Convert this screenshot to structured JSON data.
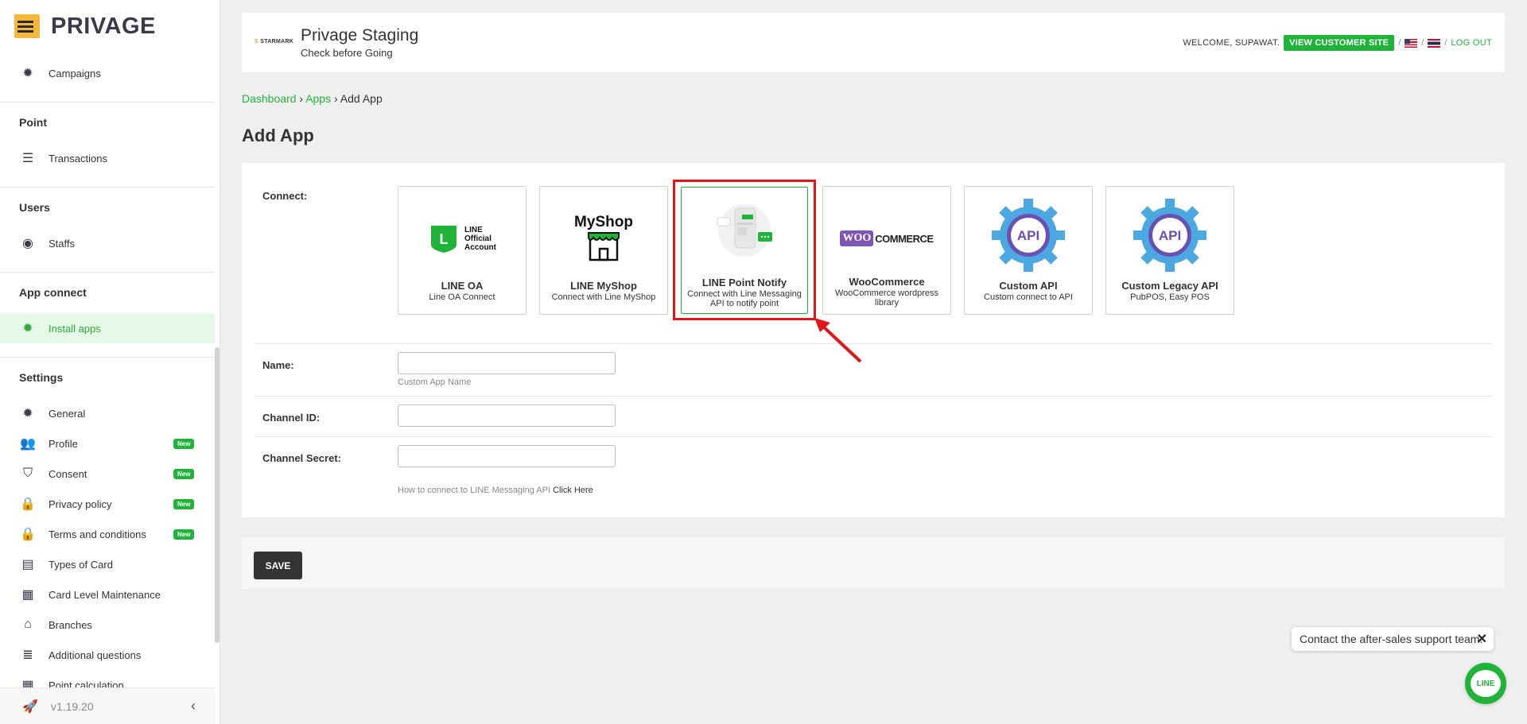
{
  "brand": {
    "name": "PRIVAGE"
  },
  "sidebar": {
    "items": [
      {
        "label": "Campaigns",
        "icon": "gear-icon"
      },
      {
        "label": "Transactions",
        "icon": "list-icon"
      },
      {
        "label": "Staffs",
        "icon": "user-circle-icon"
      },
      {
        "label": "Install apps",
        "icon": "gear-icon",
        "active": true
      },
      {
        "label": "General",
        "icon": "gear-icon"
      },
      {
        "label": "Profile",
        "icon": "users-icon",
        "badge": "New"
      },
      {
        "label": "Consent",
        "icon": "shield-icon",
        "badge": "New"
      },
      {
        "label": "Privacy policy",
        "icon": "lock-icon",
        "badge": "New"
      },
      {
        "label": "Terms and conditions",
        "icon": "lock-icon",
        "badge": "New"
      },
      {
        "label": "Types of Card",
        "icon": "id-card-icon"
      },
      {
        "label": "Card Level Maintenance",
        "icon": "document-icon"
      },
      {
        "label": "Branches",
        "icon": "store-icon"
      },
      {
        "label": "Additional questions",
        "icon": "indent-icon"
      },
      {
        "label": "Point calculation",
        "icon": "document-icon"
      }
    ],
    "sections": {
      "point": "Point",
      "users": "Users",
      "app_connect": "App connect",
      "settings": "Settings"
    },
    "version": "v1.19.20"
  },
  "header": {
    "brand_logo": "STARMARK",
    "site_title": "Privage Staging",
    "site_subtitle": "Check before Going",
    "welcome": "WELCOME, SUPAWAT.",
    "view_site": "VIEW CUSTOMER SITE",
    "separator": "/",
    "logout": "LOG OUT"
  },
  "breadcrumb": {
    "dashboard": "Dashboard",
    "apps": "Apps",
    "current": "Add App",
    "sep": "›"
  },
  "page_title": "Add App",
  "form": {
    "connect_label": "Connect:",
    "apps": [
      {
        "name": "LINE OA",
        "desc": "Line OA Connect",
        "art_lines": [
          "LINE",
          "Official",
          "Account"
        ],
        "art_letter": "L"
      },
      {
        "name": "LINE MyShop",
        "desc": "Connect with Line MyShop",
        "art_text": "MyShop"
      },
      {
        "name": "LINE Point Notify",
        "desc": "Connect with Line Messaging API to notify point",
        "selected": true
      },
      {
        "name": "WooCommerce",
        "desc": "WooCommerce wordpress library",
        "art_woo": "WOO",
        "art_commerce": "COMMERCE"
      },
      {
        "name": "Custom API",
        "desc": "Custom connect to API",
        "art_text": "API"
      },
      {
        "name": "Custom Legacy API",
        "desc": "PubPOS, Easy POS",
        "art_text": "API"
      }
    ],
    "name_label": "Name:",
    "name_value": "",
    "name_hint": "Custom App Name",
    "channel_id_label": "Channel ID:",
    "channel_id_value": "",
    "channel_secret_label": "Channel Secret:",
    "channel_secret_value": "",
    "help_text": "How to connect to LINE Messaging API",
    "help_link": "Click Here"
  },
  "save_label": "SAVE",
  "support": {
    "text": "Contact the after-sales support team.",
    "close": "✕",
    "line_label": "LINE"
  },
  "colors": {
    "accent": "#1fb33a",
    "highlight": "#e0161b",
    "api_gear": "#4ba8e0",
    "api_inner": "#6a4fb5"
  }
}
